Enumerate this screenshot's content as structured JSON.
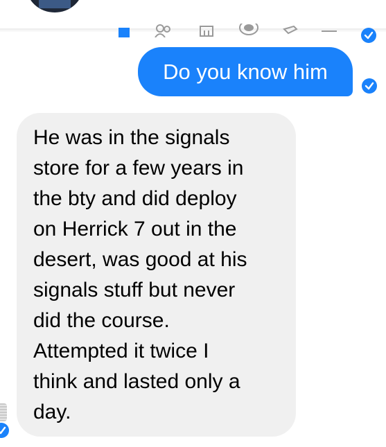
{
  "colors": {
    "accent": "#1a82fb",
    "incoming_bubble": "#f0f0f0",
    "background": "#ffffff"
  },
  "header": {
    "avatar": "contact-avatar",
    "icons": [
      "home-icon",
      "people-icon",
      "store-icon",
      "camera-icon",
      "tag-icon",
      "menu-icon"
    ]
  },
  "messages": {
    "outgoing": {
      "text": "Do you know him",
      "status_icon": "read-receipt-check-icon"
    },
    "incoming": {
      "lines": [
        "He was in the signals",
        "store for a few years in",
        "the bty and did deploy",
        "on Herrick 7 out in the",
        "desert, was good at his",
        "signals stuff but never",
        "did the course.",
        "Attempted it twice I",
        "think and lasted only a",
        "day."
      ]
    }
  }
}
